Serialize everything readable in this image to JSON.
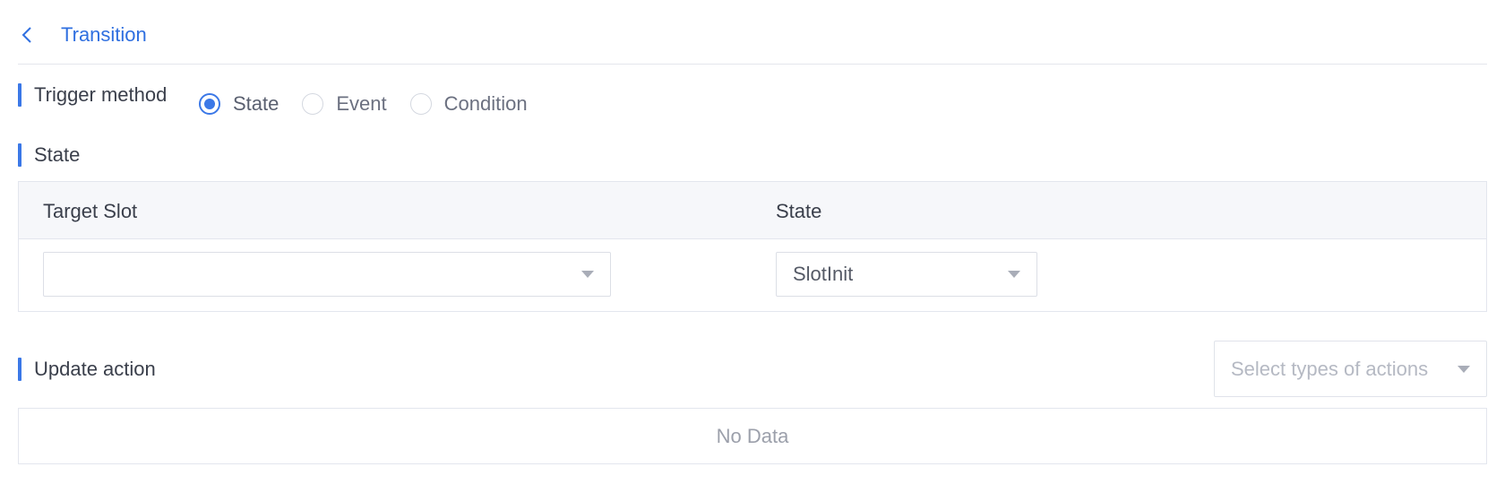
{
  "header": {
    "title": "Transition"
  },
  "trigger": {
    "label": "Trigger method",
    "options": [
      {
        "label": "State",
        "checked": true
      },
      {
        "label": "Event",
        "checked": false
      },
      {
        "label": "Condition",
        "checked": false
      }
    ]
  },
  "state_section": {
    "title": "State",
    "columns": [
      "Target Slot",
      "State"
    ],
    "row": {
      "target_slot": "",
      "state": "SlotInit"
    }
  },
  "update_action": {
    "title": "Update action",
    "select_placeholder": "Select types of actions",
    "empty_text": "No Data"
  },
  "colors": {
    "accent": "#3b78e7",
    "link": "#2f6fe0"
  },
  "icons": {
    "back": "chevron-left-icon",
    "dropdown": "caret-down-icon"
  }
}
